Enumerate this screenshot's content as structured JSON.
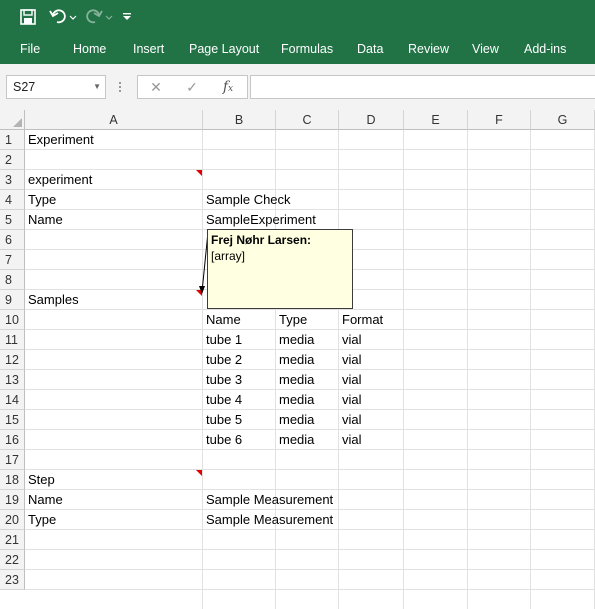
{
  "qat": {
    "save_icon": "save-icon",
    "undo_icon": "undo-icon",
    "redo_icon": "redo-icon",
    "customize_icon": "customize-qat-icon"
  },
  "ribbon": {
    "tabs": [
      "File",
      "Home",
      "Insert",
      "Page Layout",
      "Formulas",
      "Data",
      "Review",
      "View",
      "Add-ins"
    ],
    "accent": "#217346"
  },
  "formula_bar": {
    "name_box": "S27",
    "formula": ""
  },
  "grid": {
    "columns": [
      "A",
      "B",
      "C",
      "D",
      "E",
      "F",
      "G"
    ],
    "rows": [
      "1",
      "2",
      "3",
      "4",
      "5",
      "6",
      "7",
      "8",
      "9",
      "10",
      "11",
      "12",
      "13",
      "14",
      "15",
      "16",
      "17",
      "18",
      "19",
      "20",
      "21",
      "22",
      "23"
    ],
    "cells": {
      "A1": "Experiment",
      "A3": "experiment",
      "A4": "Type",
      "B4": "Sample Check",
      "A5": "Name",
      "B5": "SampleExperiment",
      "A9": "Samples",
      "B10": "Name",
      "C10": "Type",
      "D10": "Format",
      "B11": "tube 1",
      "C11": "media",
      "D11": "vial",
      "B12": "tube 2",
      "C12": "media",
      "D12": "vial",
      "B13": "tube 3",
      "C13": "media",
      "D13": "vial",
      "B14": "tube 4",
      "C14": "media",
      "D14": "vial",
      "B15": "tube 5",
      "C15": "media",
      "D15": "vial",
      "B16": "tube 6",
      "C16": "media",
      "D16": "vial",
      "A18": "Step",
      "A19": "Name",
      "B19": "Sample Measurement",
      "A20": "Type",
      "B20": "Sample Measurement"
    }
  },
  "comment": {
    "author": "Frej Nøhr Larsen:",
    "text": "[array]"
  }
}
